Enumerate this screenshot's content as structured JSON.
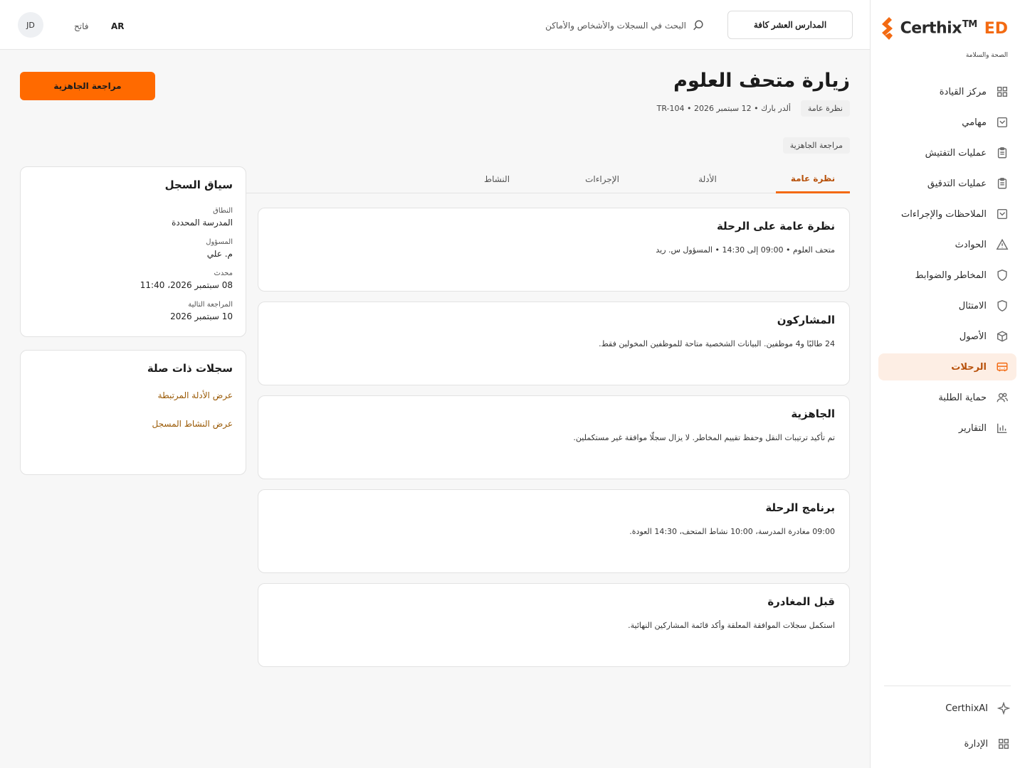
{
  "brand": {
    "name": "Certhix",
    "tm": "TM",
    "suffix": "ED",
    "subtitle": "الصحة والسلامة"
  },
  "sidebar": {
    "items": [
      {
        "label": "مركز القيادة",
        "icon": "grid-icon"
      },
      {
        "label": "مهامي",
        "icon": "check-square-icon"
      },
      {
        "label": "عمليات التفتيش",
        "icon": "clipboard-icon"
      },
      {
        "label": "عمليات التدقيق",
        "icon": "clipboard-icon"
      },
      {
        "label": "الملاحظات والإجراءات",
        "icon": "check-square-icon"
      },
      {
        "label": "الحوادث",
        "icon": "warning-icon"
      },
      {
        "label": "المخاطر والضوابط",
        "icon": "shield-icon"
      },
      {
        "label": "الامتثال",
        "icon": "shield-icon"
      },
      {
        "label": "الأصول",
        "icon": "cube-icon"
      },
      {
        "label": "الرحلات",
        "icon": "bus-icon",
        "active": true
      },
      {
        "label": "حماية الطلبة",
        "icon": "users-icon"
      },
      {
        "label": "التقارير",
        "icon": "bar-chart-icon"
      }
    ],
    "bottom": [
      {
        "label": "CerthixAI",
        "icon": "sparkle-icon"
      },
      {
        "label": "الإدارة",
        "icon": "grid-icon"
      }
    ]
  },
  "topbar": {
    "school_select": "المدارس العشر كافة",
    "search_placeholder": "البحث في السجلات والأشخاص والأماكن",
    "lang": "AR",
    "theme": "فاتح",
    "avatar": "JD"
  },
  "page": {
    "title": "زيارة متحف العلوم",
    "pill": "نظرة عامة",
    "meta": "ألدر بارك • 12 سبتمبر 2026 • TR-104",
    "status_pill": "مراجعة الجاهزية",
    "primary_button": "مراجعة الجاهزية"
  },
  "tabs": [
    {
      "label": "نظرة عامة",
      "active": true
    },
    {
      "label": "الأدلة"
    },
    {
      "label": "الإجراءات"
    },
    {
      "label": "النشاط"
    }
  ],
  "cards": [
    {
      "title": "نظرة عامة على الرحلة",
      "body": "متحف العلوم • 09:00 إلى 14:30 • المسؤول س. ريد"
    },
    {
      "title": "المشاركون",
      "body": "24 طالبًا و4 موظفين. البيانات الشخصية متاحة للموظفين المخولين فقط."
    },
    {
      "title": "الجاهزية",
      "body": "تم تأكيد ترتيبات النقل وحفظ تقييم المخاطر. لا يزال سجلّا موافقة غير مستكملين."
    },
    {
      "title": "برنامج الرحلة",
      "body": "09:00 مغادرة المدرسة، 10:00 نشاط المتحف، 14:30 العودة."
    },
    {
      "title": "قبل المغادرة",
      "body": "استكمل سجلات الموافقة المعلقة وأكد قائمة المشاركين النهائية."
    }
  ],
  "context": {
    "title": "سياق السجل",
    "fields": [
      {
        "label": "النطاق",
        "value": "المدرسة المحددة"
      },
      {
        "label": "المسؤول",
        "value": "م. علي"
      },
      {
        "label": "محدث",
        "value": "08 سبتمبر 2026، 11:40"
      },
      {
        "label": "المراجعة التالية",
        "value": "10 سبتمبر 2026"
      }
    ]
  },
  "related": {
    "title": "سجلات ذات صلة",
    "links": [
      "عرض الأدلة المرتبطة",
      "عرض النشاط المسجل"
    ]
  },
  "colors": {
    "accent": "#f36a12",
    "button": "#ff6a00",
    "link": "#9a5a06",
    "active_bg": "#fdeee4"
  }
}
